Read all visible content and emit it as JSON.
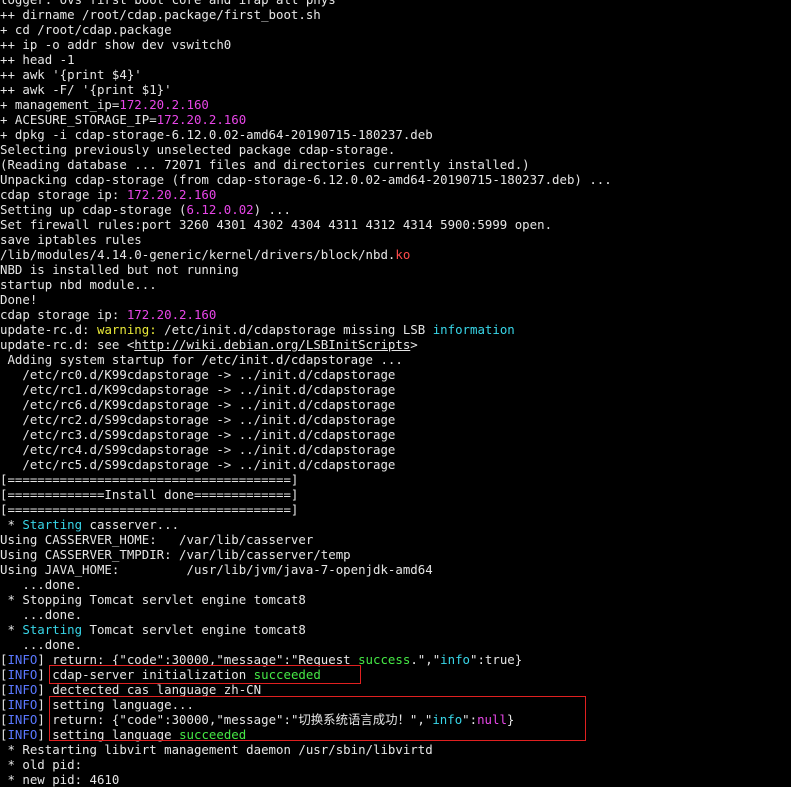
{
  "colors": {
    "background": "#000000",
    "text": "#e6e6e6",
    "green": "#45e845",
    "cyan": "#38d6e8",
    "magenta": "#e846e8",
    "red": "#ff4b4b",
    "yellow": "#e8e838",
    "blue": "#5a78ff",
    "highlight_box": "#e02020"
  },
  "terminal": {
    "lines": [
      [
        {
          "t": "logger: ovs first boot core and irap all phys",
          "c": "w"
        }
      ],
      [
        {
          "t": "++ dirname /root/cdap.package/first_boot.sh",
          "c": "w"
        }
      ],
      [
        {
          "t": "+ cd /root/cdap.package",
          "c": "w"
        }
      ],
      [
        {
          "t": "++ ip -o addr show dev vswitch0",
          "c": "w"
        }
      ],
      [
        {
          "t": "++ head -1",
          "c": "w"
        }
      ],
      [
        {
          "t": "++ awk '{print $4}'",
          "c": "w"
        }
      ],
      [
        {
          "t": "++ awk -F/ '{print $1}'",
          "c": "w"
        }
      ],
      [
        {
          "t": "+ management_ip=",
          "c": "w"
        },
        {
          "t": "172.20.2.160",
          "c": "m"
        }
      ],
      [
        {
          "t": "+ ACESURE_STORAGE_IP=",
          "c": "w"
        },
        {
          "t": "172.20.2.160",
          "c": "m"
        }
      ],
      [
        {
          "t": "+ dpkg -i cdap-storage-6.12.0.02-amd64-20190715-180237.deb",
          "c": "w"
        }
      ],
      [
        {
          "t": "Selecting previously unselected package cdap-storage.",
          "c": "w"
        }
      ],
      [
        {
          "t": "(Reading database ... 72071 files and directories currently installed.)",
          "c": "w"
        }
      ],
      [
        {
          "t": "Unpacking cdap-storage (from cdap-storage-6.12.0.02-amd64-20190715-180237.deb) ...",
          "c": "w"
        }
      ],
      [
        {
          "t": "cdap storage ip: ",
          "c": "w"
        },
        {
          "t": "172.20.2.160",
          "c": "m"
        }
      ],
      [
        {
          "t": "Setting up cdap-storage (",
          "c": "w"
        },
        {
          "t": "6.12.0.02",
          "c": "m"
        },
        {
          "t": ") ...",
          "c": "w"
        }
      ],
      [
        {
          "t": "Set firewall rules:port 3260 4301 4302 4304 4311 4312 4314 5900:5999 open.",
          "c": "w"
        }
      ],
      [
        {
          "t": "save iptables rules",
          "c": "w"
        }
      ],
      [
        {
          "t": "/lib/modules/4.14.0-generic/kernel/drivers/block/nbd.",
          "c": "w"
        },
        {
          "t": "ko",
          "c": "r"
        }
      ],
      [
        {
          "t": "NBD is installed but not running",
          "c": "w"
        }
      ],
      [
        {
          "t": "startup nbd module...",
          "c": "w"
        }
      ],
      [
        {
          "t": "Done!",
          "c": "w"
        }
      ],
      [
        {
          "t": "cdap storage ip: ",
          "c": "w"
        },
        {
          "t": "172.20.2.160",
          "c": "m"
        }
      ],
      [
        {
          "t": "update-rc.d: ",
          "c": "w"
        },
        {
          "t": "warning:",
          "c": "y"
        },
        {
          "t": " /etc/init.d/cdapstorage missing LSB ",
          "c": "w"
        },
        {
          "t": "information",
          "c": "c"
        }
      ],
      [
        {
          "t": "update-rc.d: see <",
          "c": "w"
        },
        {
          "t": "http://wiki.debian.org/LSBInitScripts",
          "c": "w",
          "u": true
        },
        {
          "t": ">",
          "c": "w"
        }
      ],
      [
        {
          "t": " Adding system startup for /etc/init.d/cdapstorage ...",
          "c": "w"
        }
      ],
      [
        {
          "t": "   /etc/rc0.d/K99cdapstorage -> ../init.d/cdapstorage",
          "c": "w"
        }
      ],
      [
        {
          "t": "   /etc/rc1.d/K99cdapstorage -> ../init.d/cdapstorage",
          "c": "w"
        }
      ],
      [
        {
          "t": "   /etc/rc6.d/K99cdapstorage -> ../init.d/cdapstorage",
          "c": "w"
        }
      ],
      [
        {
          "t": "   /etc/rc2.d/S99cdapstorage -> ../init.d/cdapstorage",
          "c": "w"
        }
      ],
      [
        {
          "t": "   /etc/rc3.d/S99cdapstorage -> ../init.d/cdapstorage",
          "c": "w"
        }
      ],
      [
        {
          "t": "   /etc/rc4.d/S99cdapstorage -> ../init.d/cdapstorage",
          "c": "w"
        }
      ],
      [
        {
          "t": "   /etc/rc5.d/S99cdapstorage -> ../init.d/cdapstorage",
          "c": "w"
        }
      ],
      [
        {
          "t": "[======================================]",
          "c": "w"
        }
      ],
      [
        {
          "t": "[=============Install done=============]",
          "c": "w"
        }
      ],
      [
        {
          "t": "[======================================]",
          "c": "w"
        }
      ],
      [
        {
          "t": " * ",
          "c": "w"
        },
        {
          "t": "Starting",
          "c": "c"
        },
        {
          "t": " casserver...",
          "c": "w"
        }
      ],
      [
        {
          "t": "Using CASSERVER_HOME:   /var/lib/casserver",
          "c": "w"
        }
      ],
      [
        {
          "t": "Using CASSERVER_TMPDIR: /var/lib/casserver/temp",
          "c": "w"
        }
      ],
      [
        {
          "t": "Using JAVA_HOME:         /usr/lib/jvm/java-7-openjdk-amd64",
          "c": "w"
        }
      ],
      [
        {
          "t": "   ...done.",
          "c": "w"
        }
      ],
      [
        {
          "t": " * Stopping Tomcat servlet engine tomcat8",
          "c": "w"
        }
      ],
      [
        {
          "t": "   ...done.",
          "c": "w"
        }
      ],
      [
        {
          "t": " * ",
          "c": "w"
        },
        {
          "t": "Starting",
          "c": "c"
        },
        {
          "t": " Tomcat servlet engine tomcat8",
          "c": "w"
        }
      ],
      [
        {
          "t": "   ...done.",
          "c": "w"
        }
      ],
      [
        {
          "t": "[",
          "c": "w"
        },
        {
          "t": "INFO",
          "c": "b"
        },
        {
          "t": "] return: {\"code\":30000,\"message\":\"Request ",
          "c": "w"
        },
        {
          "t": "success",
          "c": "g"
        },
        {
          "t": ".\",\"",
          "c": "w"
        },
        {
          "t": "info",
          "c": "c"
        },
        {
          "t": "\":true}",
          "c": "w"
        }
      ],
      [
        {
          "t": "[",
          "c": "w"
        },
        {
          "t": "INFO",
          "c": "b"
        },
        {
          "t": "] cdap-server initialization ",
          "c": "w"
        },
        {
          "t": "succeeded",
          "c": "g"
        }
      ],
      [
        {
          "t": "[",
          "c": "w"
        },
        {
          "t": "INFO",
          "c": "b"
        },
        {
          "t": "] dectected cas language zh-CN",
          "c": "w"
        }
      ],
      [
        {
          "t": "[",
          "c": "w"
        },
        {
          "t": "INFO",
          "c": "b"
        },
        {
          "t": "] setting language...",
          "c": "w"
        }
      ],
      [
        {
          "t": "[",
          "c": "w"
        },
        {
          "t": "INFO",
          "c": "b"
        },
        {
          "t": "] return: {\"code\":30000,\"message\":\"切换系统语言成功！\",\"",
          "c": "w"
        },
        {
          "t": "info",
          "c": "c"
        },
        {
          "t": "\":",
          "c": "w"
        },
        {
          "t": "null",
          "c": "m"
        },
        {
          "t": "}",
          "c": "w"
        }
      ],
      [
        {
          "t": "[",
          "c": "w"
        },
        {
          "t": "INFO",
          "c": "b"
        },
        {
          "t": "] setting language ",
          "c": "w"
        },
        {
          "t": "succeeded",
          "c": "g"
        }
      ],
      [
        {
          "t": " * Restarting libvirt management daemon /usr/sbin/libvirtd",
          "c": "w"
        }
      ],
      [
        {
          "t": " * old pid:",
          "c": "w"
        }
      ],
      [
        {
          "t": " * new pid: 4610",
          "c": "w"
        }
      ]
    ]
  }
}
